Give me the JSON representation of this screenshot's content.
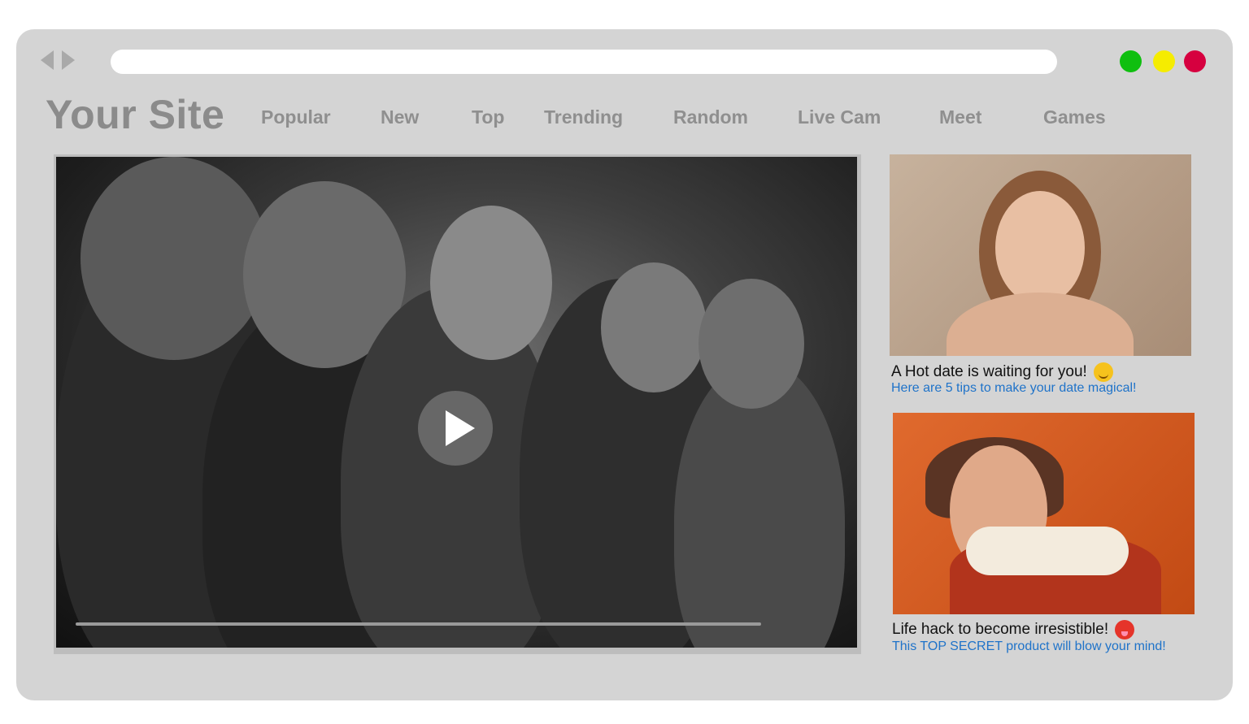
{
  "browser": {
    "back_icon": "back-arrow-icon",
    "forward_icon": "forward-arrow-icon",
    "url": "",
    "window_controls": [
      {
        "name": "green",
        "color": "#0fbf0f"
      },
      {
        "name": "yellow",
        "color": "#f5ec00"
      },
      {
        "name": "red",
        "color": "#d6003f"
      }
    ]
  },
  "site": {
    "logo": "Your Site",
    "nav": [
      "Popular",
      "New",
      "Top",
      "Trending",
      "Random",
      "Live Cam",
      "Meet",
      "Games"
    ]
  },
  "video": {
    "play_icon": "play-icon",
    "progress": 0.0
  },
  "ads": [
    {
      "title": "A Hot date is waiting for you!",
      "emoji": "smiling-face-with-heart-eyes-icon",
      "subtitle": "Here are 5 tips to make your date magical!"
    },
    {
      "title": "Life hack to become irresistible!",
      "emoji": "hot-face-icon",
      "subtitle": "This TOP SECRET product will blow your mind!"
    }
  ],
  "colors": {
    "window_bg": "#d4d4d4",
    "nav_text": "#8f8f8f",
    "link": "#1f73c9"
  }
}
